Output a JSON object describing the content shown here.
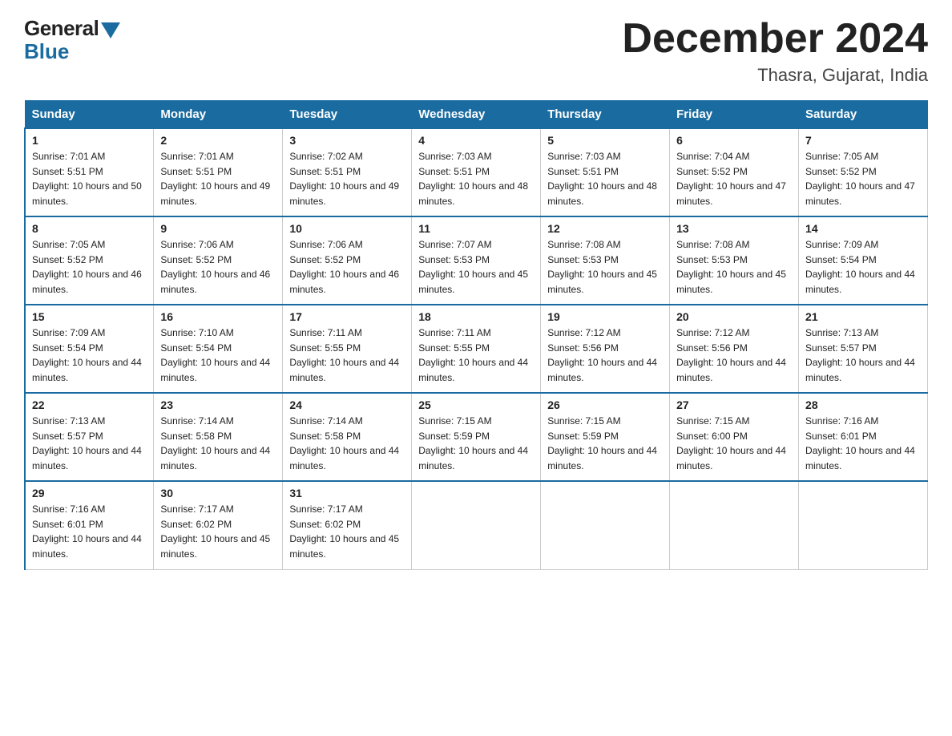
{
  "header": {
    "logo_general": "General",
    "logo_blue": "Blue",
    "month_title": "December 2024",
    "location": "Thasra, Gujarat, India"
  },
  "days_of_week": [
    "Sunday",
    "Monday",
    "Tuesday",
    "Wednesday",
    "Thursday",
    "Friday",
    "Saturday"
  ],
  "weeks": [
    [
      {
        "day": "1",
        "sunrise": "7:01 AM",
        "sunset": "5:51 PM",
        "daylight": "10 hours and 50 minutes."
      },
      {
        "day": "2",
        "sunrise": "7:01 AM",
        "sunset": "5:51 PM",
        "daylight": "10 hours and 49 minutes."
      },
      {
        "day": "3",
        "sunrise": "7:02 AM",
        "sunset": "5:51 PM",
        "daylight": "10 hours and 49 minutes."
      },
      {
        "day": "4",
        "sunrise": "7:03 AM",
        "sunset": "5:51 PM",
        "daylight": "10 hours and 48 minutes."
      },
      {
        "day": "5",
        "sunrise": "7:03 AM",
        "sunset": "5:51 PM",
        "daylight": "10 hours and 48 minutes."
      },
      {
        "day": "6",
        "sunrise": "7:04 AM",
        "sunset": "5:52 PM",
        "daylight": "10 hours and 47 minutes."
      },
      {
        "day": "7",
        "sunrise": "7:05 AM",
        "sunset": "5:52 PM",
        "daylight": "10 hours and 47 minutes."
      }
    ],
    [
      {
        "day": "8",
        "sunrise": "7:05 AM",
        "sunset": "5:52 PM",
        "daylight": "10 hours and 46 minutes."
      },
      {
        "day": "9",
        "sunrise": "7:06 AM",
        "sunset": "5:52 PM",
        "daylight": "10 hours and 46 minutes."
      },
      {
        "day": "10",
        "sunrise": "7:06 AM",
        "sunset": "5:52 PM",
        "daylight": "10 hours and 46 minutes."
      },
      {
        "day": "11",
        "sunrise": "7:07 AM",
        "sunset": "5:53 PM",
        "daylight": "10 hours and 45 minutes."
      },
      {
        "day": "12",
        "sunrise": "7:08 AM",
        "sunset": "5:53 PM",
        "daylight": "10 hours and 45 minutes."
      },
      {
        "day": "13",
        "sunrise": "7:08 AM",
        "sunset": "5:53 PM",
        "daylight": "10 hours and 45 minutes."
      },
      {
        "day": "14",
        "sunrise": "7:09 AM",
        "sunset": "5:54 PM",
        "daylight": "10 hours and 44 minutes."
      }
    ],
    [
      {
        "day": "15",
        "sunrise": "7:09 AM",
        "sunset": "5:54 PM",
        "daylight": "10 hours and 44 minutes."
      },
      {
        "day": "16",
        "sunrise": "7:10 AM",
        "sunset": "5:54 PM",
        "daylight": "10 hours and 44 minutes."
      },
      {
        "day": "17",
        "sunrise": "7:11 AM",
        "sunset": "5:55 PM",
        "daylight": "10 hours and 44 minutes."
      },
      {
        "day": "18",
        "sunrise": "7:11 AM",
        "sunset": "5:55 PM",
        "daylight": "10 hours and 44 minutes."
      },
      {
        "day": "19",
        "sunrise": "7:12 AM",
        "sunset": "5:56 PM",
        "daylight": "10 hours and 44 minutes."
      },
      {
        "day": "20",
        "sunrise": "7:12 AM",
        "sunset": "5:56 PM",
        "daylight": "10 hours and 44 minutes."
      },
      {
        "day": "21",
        "sunrise": "7:13 AM",
        "sunset": "5:57 PM",
        "daylight": "10 hours and 44 minutes."
      }
    ],
    [
      {
        "day": "22",
        "sunrise": "7:13 AM",
        "sunset": "5:57 PM",
        "daylight": "10 hours and 44 minutes."
      },
      {
        "day": "23",
        "sunrise": "7:14 AM",
        "sunset": "5:58 PM",
        "daylight": "10 hours and 44 minutes."
      },
      {
        "day": "24",
        "sunrise": "7:14 AM",
        "sunset": "5:58 PM",
        "daylight": "10 hours and 44 minutes."
      },
      {
        "day": "25",
        "sunrise": "7:15 AM",
        "sunset": "5:59 PM",
        "daylight": "10 hours and 44 minutes."
      },
      {
        "day": "26",
        "sunrise": "7:15 AM",
        "sunset": "5:59 PM",
        "daylight": "10 hours and 44 minutes."
      },
      {
        "day": "27",
        "sunrise": "7:15 AM",
        "sunset": "6:00 PM",
        "daylight": "10 hours and 44 minutes."
      },
      {
        "day": "28",
        "sunrise": "7:16 AM",
        "sunset": "6:01 PM",
        "daylight": "10 hours and 44 minutes."
      }
    ],
    [
      {
        "day": "29",
        "sunrise": "7:16 AM",
        "sunset": "6:01 PM",
        "daylight": "10 hours and 44 minutes."
      },
      {
        "day": "30",
        "sunrise": "7:17 AM",
        "sunset": "6:02 PM",
        "daylight": "10 hours and 45 minutes."
      },
      {
        "day": "31",
        "sunrise": "7:17 AM",
        "sunset": "6:02 PM",
        "daylight": "10 hours and 45 minutes."
      },
      null,
      null,
      null,
      null
    ]
  ]
}
